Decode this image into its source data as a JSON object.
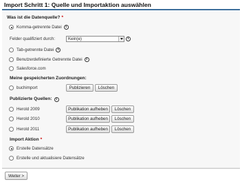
{
  "title": "Import Schritt 1: Quelle und Importaktion auswählen",
  "data_source": {
    "heading": "Was ist die Datenquelle?",
    "required_marker": "*",
    "options": [
      {
        "label": "Komma-getrennte Datei",
        "checked": true,
        "info_icon": true
      },
      {
        "label": "Tab-getrennte Datei",
        "checked": false,
        "info_icon": true
      },
      {
        "label": "Benutzerdefinierte Getrennte Datei",
        "checked": false,
        "info_icon": true
      },
      {
        "label": "Salesforce.com",
        "checked": false,
        "info_icon": false
      }
    ],
    "qualifier": {
      "label": "Felder qualifiziert durch:",
      "value": "Kein(e)"
    }
  },
  "saved_mappings": {
    "heading": "Meine gespeicherten Zuordnungen:",
    "items": [
      {
        "label": "buchimport",
        "checked": false,
        "buttons": [
          "Publizieren",
          "Löschen"
        ]
      }
    ]
  },
  "published_sources": {
    "heading": "Publizierte Quellen:",
    "items": [
      {
        "label": "Herold 2009",
        "checked": false,
        "buttons": [
          "Publikation aufheben",
          "Löschen"
        ]
      },
      {
        "label": "Herold 2010",
        "checked": false,
        "buttons": [
          "Publikation aufheben",
          "Löschen"
        ]
      },
      {
        "label": "Herold 2011",
        "checked": false,
        "buttons": [
          "Publikation aufheben",
          "Löschen"
        ]
      }
    ]
  },
  "import_action": {
    "heading": "Import Aktion",
    "required_marker": "*",
    "options": [
      {
        "label": "Erstelle Datensätze",
        "checked": true
      },
      {
        "label": "Erstelle und aktualisiere Datensätze",
        "checked": false
      }
    ]
  },
  "next_button": "Weiter >",
  "info_glyph": "i",
  "colors": {
    "title_rule": "#3d6f9c",
    "required": "#cc0000"
  }
}
